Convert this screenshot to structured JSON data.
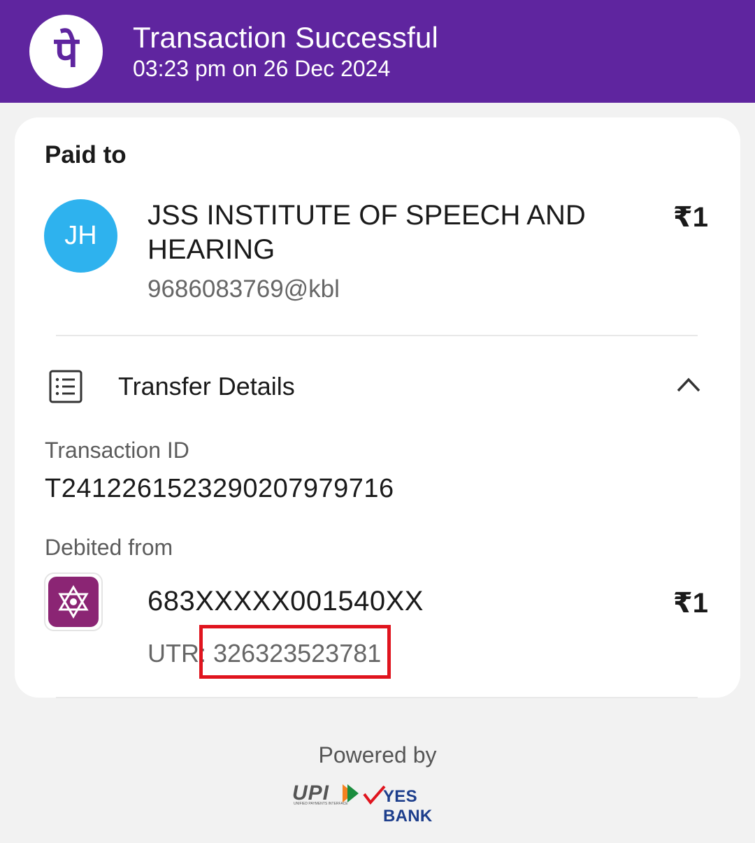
{
  "header": {
    "title": "Transaction Successful",
    "subtitle": "03:23 pm on 26 Dec 2024",
    "bg_color": "#5f259f"
  },
  "paid_to": {
    "label": "Paid to",
    "avatar_initials": "JH",
    "avatar_color": "#2eb2ee",
    "name": "JSS INSTITUTE OF SPEECH AND HEARING",
    "upi_id": "9686083769@kbl",
    "amount": "₹1"
  },
  "transfer_details": {
    "title": "Transfer Details",
    "icon": "list-icon",
    "transaction_id_label": "Transaction ID",
    "transaction_id": "T2412261523290207979716",
    "debited_from_label": "Debited from",
    "account": "683XXXXX001540XX",
    "amount": "₹1",
    "utr_label": "UTR: ",
    "utr": "326323523781"
  },
  "footer": {
    "powered_by": "Powered by",
    "upi_logo": "UPI",
    "upi_tagline": "UNIFIED PAYMENTS INTERFACE",
    "bank_name": "YES BANK"
  }
}
